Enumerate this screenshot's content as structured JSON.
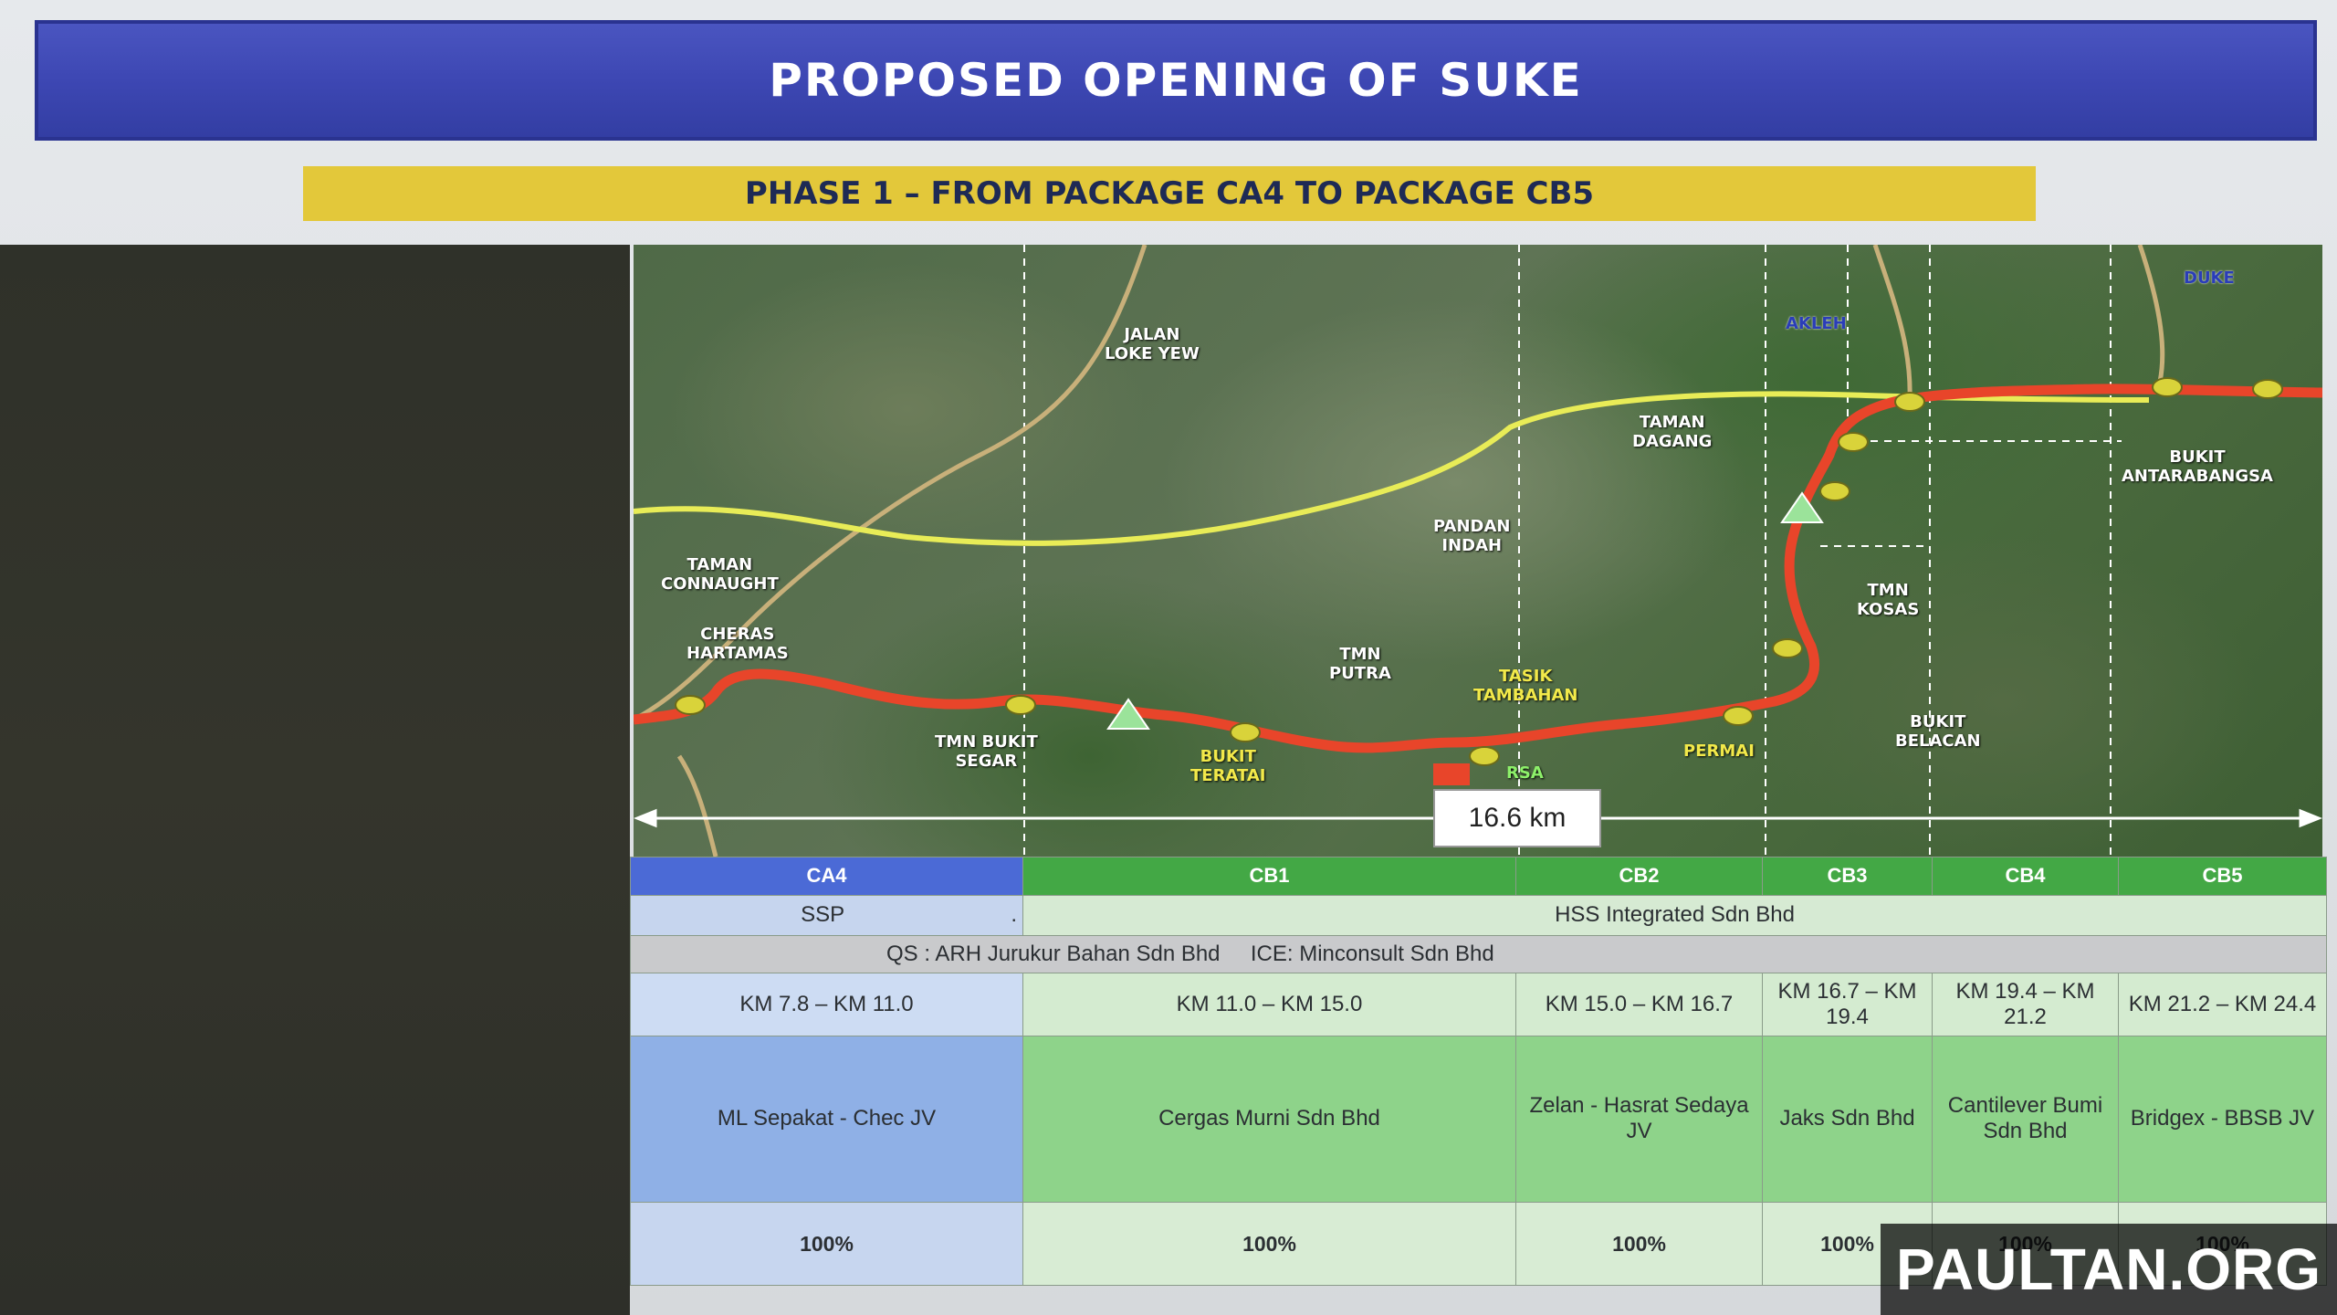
{
  "title": "PROPOSED OPENING OF SUKE",
  "phase": "PHASE 1 – FROM PACKAGE CA4 TO PACKAGE CB5",
  "map": {
    "labels": {
      "jalan_loke_yew": "JALAN\nLOKE YEW",
      "akleh": "AKLEH",
      "duke": "DUKE",
      "taman_dagang": "TAMAN\nDAGANG",
      "bukit_antarabangsa": "BUKIT\nANTARABANGSA",
      "pandan_indah": "PANDAN\nINDAH",
      "taman_connaught": "TAMAN\nCONNAUGHT",
      "tmn_kosas": "TMN\nKOSAS",
      "cheras_hartamas": "CHERAS\nHARTAMAS",
      "tmn_putra": "TMN\nPUTRA",
      "tasik_tambahan": "TASIK\nTAMBAHAN",
      "bukit_belacan": "BUKIT\nBELACAN",
      "tmn_bukit_segar": "TMN BUKIT\nSEGAR",
      "bukit_teratai": "BUKIT\nTERATAI",
      "permai": "PERMAI",
      "rsa": "RSA"
    },
    "distance": "16.6 km"
  },
  "table": {
    "headers": [
      "CA4",
      "CB1",
      "CB2",
      "CB3",
      "CB4",
      "CB5"
    ],
    "owner": {
      "ca4": "SSP",
      "dot": ".",
      "rest": "HSS Integrated Sdn Bhd"
    },
    "qs": "QS : ARH Jurukur Bahan Sdn Bhd     ICE: Minconsult Sdn Bhd",
    "km": [
      "KM 7.8 – KM 11.0",
      "KM 11.0 – KM 15.0",
      "KM 15.0 – KM 16.7",
      "KM 16.7 – KM 19.4",
      "KM 19.4 – KM 21.2",
      "KM 21.2 – KM 24.4"
    ],
    "contractors": [
      "ML Sepakat - Chec JV",
      "Cergas Murni Sdn Bhd",
      "Zelan - Hasrat Sedaya JV",
      "Jaks Sdn Bhd",
      "Cantilever Bumi Sdn Bhd",
      "Bridgex - BBSB JV"
    ],
    "progress": [
      "100%",
      "100%",
      "100%",
      "100%",
      "100%",
      "100%"
    ]
  },
  "watermark": "PAULTAN.ORG",
  "colors": {
    "title_bg": "#3d47b3",
    "phase_bg": "#e3c83a",
    "route": "#e8452a",
    "highway": "#e8ec57",
    "ca4_header": "#4b6ad6",
    "cb_header": "#43a845"
  }
}
